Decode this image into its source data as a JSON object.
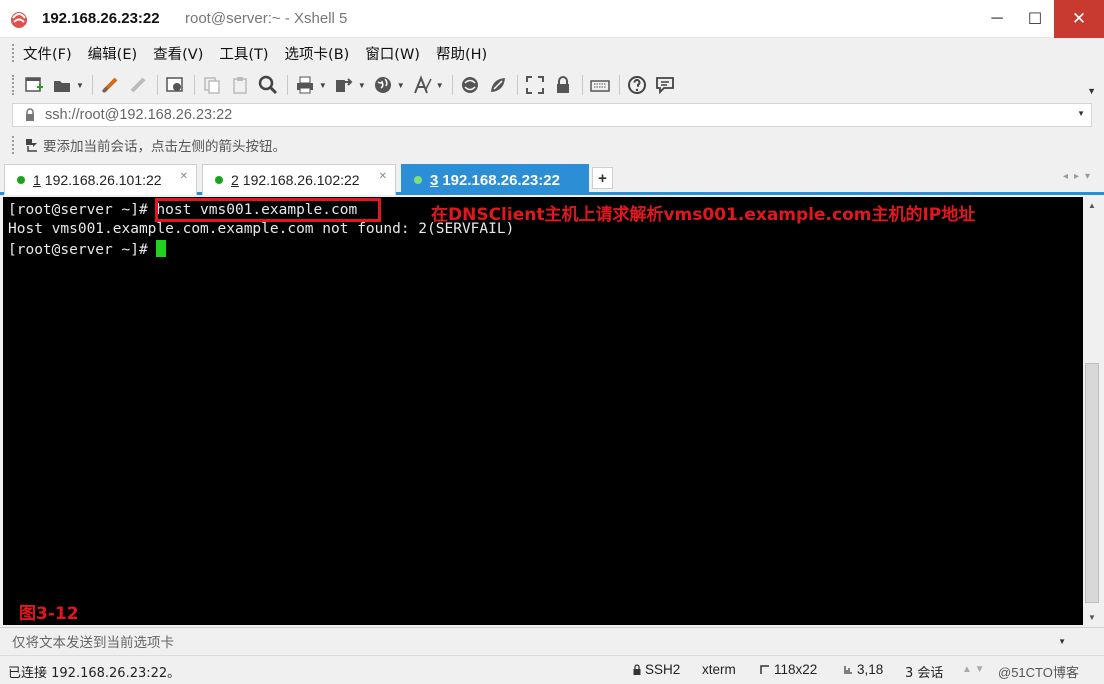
{
  "window": {
    "title_host": "192.168.26.23:22",
    "title_rest": "root@server:~ - Xshell 5",
    "minimize_glyph": "─",
    "maximize_glyph": "☐",
    "close_glyph": "✕"
  },
  "menu": [
    {
      "label": "文件(F)"
    },
    {
      "label": "编辑(E)"
    },
    {
      "label": "查看(V)"
    },
    {
      "label": "工具(T)"
    },
    {
      "label": "选项卡(B)"
    },
    {
      "label": "窗口(W)"
    },
    {
      "label": "帮助(H)"
    }
  ],
  "toolbar_icons": [
    "new-session-icon",
    "open-folder-icon",
    "reconnect-icon",
    "disconnect-icon",
    "properties-icon",
    "copy-icon",
    "paste-icon",
    "find-icon",
    "print-icon",
    "transfer-icon",
    "globe-icon",
    "font-icon",
    "xftp-icon",
    "xmanager-icon",
    "fullscreen-icon",
    "lock-icon",
    "keyboard-icon",
    "help-icon",
    "chat-icon"
  ],
  "address": {
    "value": "ssh://root@192.168.26.23:22"
  },
  "hint": {
    "text": "要添加当前会话，点击左侧的箭头按钮。"
  },
  "tabs": [
    {
      "num": "1",
      "label": "192.168.26.101:22",
      "active": false
    },
    {
      "num": "2",
      "label": "192.168.26.102:22",
      "active": false
    },
    {
      "num": "3",
      "label": "192.168.26.23:22",
      "active": true
    }
  ],
  "tab_add_glyph": "+",
  "terminal": {
    "line1_prompt": "[root@server ~]# ",
    "line1_cmd": "host vms001.example.com",
    "line2": "Host vms001.example.com.example.com not found: 2(SERVFAIL)",
    "line3_prompt": "[root@server ~]# ",
    "annotation": "在DNSClient主机上请求解析vms001.example.com主机的IP地址",
    "figure_label": "图3-12",
    "colors": {
      "background": "#000000",
      "text": "#e8e8e8",
      "cursor": "#1ed51e",
      "highlight": "#e1171f"
    }
  },
  "send_bar": {
    "placeholder": "仅将文本发送到当前选项卡"
  },
  "status": {
    "connection": "已连接 192.168.26.23:22。",
    "protocol": "SSH2",
    "terminal_type": "xterm",
    "size": "118x22",
    "cursor_pos": "3,18",
    "sessions": "3 会话",
    "credit": "@51CTO博客"
  },
  "accent_color": "#2c8fd6"
}
